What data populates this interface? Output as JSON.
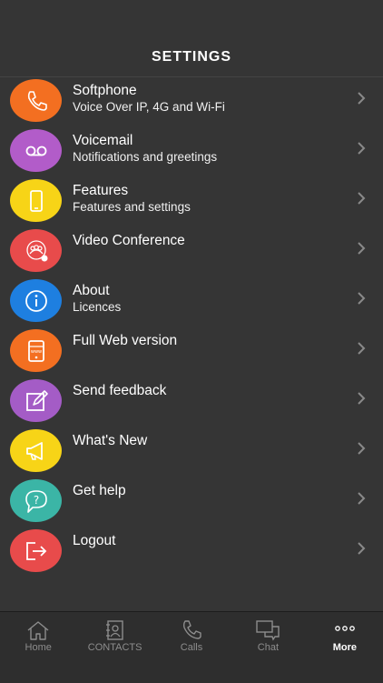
{
  "header": {
    "title": "SETTINGS"
  },
  "items": [
    {
      "label": "Softphone",
      "sub": "Voice Over IP, 4G and Wi-Fi",
      "color": "#f36f21",
      "icon": "phone-icon"
    },
    {
      "label": "Voicemail",
      "sub": "Notifications and greetings",
      "color": "#b25cc9",
      "icon": "voicemail-icon"
    },
    {
      "label": "Features",
      "sub": "Features and settings",
      "color": "#f7d417",
      "icon": "mobile-device-icon"
    },
    {
      "label": "Video Conference",
      "sub": "",
      "color": "#e84b4b",
      "icon": "video-conference-icon"
    },
    {
      "label": "About",
      "sub": "Licences",
      "color": "#1e7fe0",
      "icon": "info-icon"
    },
    {
      "label": "Full Web version",
      "sub": "",
      "color": "#f36f21",
      "icon": "web-icon"
    },
    {
      "label": "Send feedback",
      "sub": "",
      "color": "#a45cc6",
      "icon": "edit-icon"
    },
    {
      "label": "What's New",
      "sub": "",
      "color": "#f7d417",
      "icon": "megaphone-icon"
    },
    {
      "label": "Get help",
      "sub": "",
      "color": "#3bb5a6",
      "icon": "help-icon"
    },
    {
      "label": "Logout",
      "sub": "",
      "color": "#e84b4b",
      "icon": "logout-icon"
    }
  ],
  "tabs": [
    {
      "label": "Home",
      "icon": "home-icon"
    },
    {
      "label": "CONTACTS",
      "icon": "contacts-icon"
    },
    {
      "label": "Calls",
      "icon": "phone-icon"
    },
    {
      "label": "Chat",
      "icon": "chat-icon"
    },
    {
      "label": "More",
      "icon": "more-icon",
      "active": true
    }
  ]
}
